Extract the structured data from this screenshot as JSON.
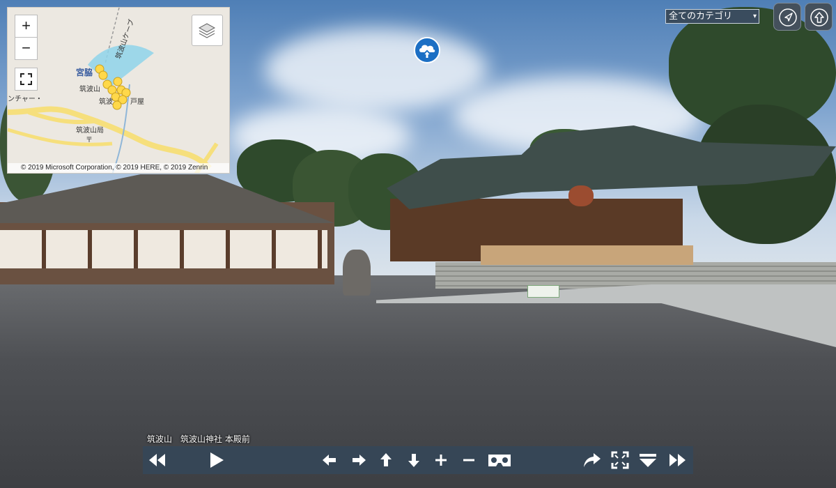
{
  "minimap": {
    "zoom_in_label": "+",
    "zoom_out_label": "−",
    "labels": {
      "ropeway": "筑波山ケーブ",
      "miyawaki": "宮脇",
      "tsukubasan": "筑波山",
      "tsukuba_short": "筑波",
      "toya": "戸屋",
      "center": "ンチャー・",
      "post_office": "筑波山局"
    },
    "attribution": "© 2019 Microsoft Corporation, © 2019 HERE, © 2019 Zenrin"
  },
  "header": {
    "category_label": "全てのカテゴリ",
    "category_caret": "▾"
  },
  "caption": {
    "area": "筑波山",
    "location": "筑波山神社 本殿前"
  },
  "controls": {
    "buttons": [
      "previous",
      "play",
      "pan-left",
      "pan-right",
      "pan-up",
      "pan-down",
      "zoom-in",
      "zoom-out",
      "vr",
      "share",
      "fullscreen",
      "menu",
      "next"
    ]
  },
  "colors": {
    "accent_blue": "#1c6fc4",
    "bar_bg": "#354658",
    "map_marker": "#ffd84a",
    "map_fov": "#8fd3ea"
  }
}
